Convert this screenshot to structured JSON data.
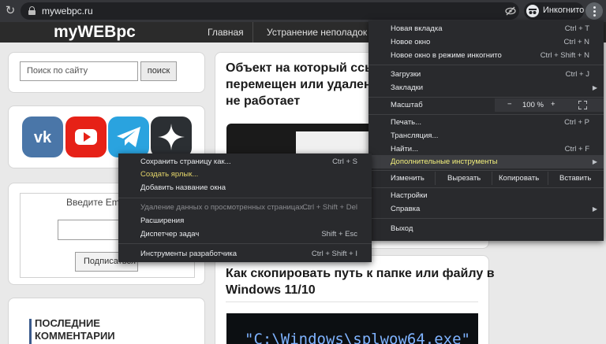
{
  "browser": {
    "url": "mywebpc.ru",
    "incognito_label": "Инкогнито"
  },
  "site": {
    "logo": "myWEBpc",
    "nav": [
      "Главная",
      "Устранение неполадок Win"
    ]
  },
  "sidebar": {
    "search_placeholder": "Поиск по сайту",
    "search_button": "поиск",
    "email_prompt": "Введите Email",
    "subscribe_button": "Подписаться",
    "comments_heading_line1": "ПОСЛЕДНИЕ",
    "comments_heading_line2": "КОММЕНТАРИИ",
    "socials": [
      {
        "name": "vk",
        "color": "#4a76a8"
      },
      {
        "name": "youtube",
        "color": "#e62117"
      },
      {
        "name": "telegram",
        "color": "#2aa3df"
      },
      {
        "name": "zen",
        "color": "#2b2f33"
      }
    ]
  },
  "articles": [
    {
      "title_line1": "Объект на который ссыл",
      "title_line2": "перемещен или удален, к",
      "title_line3": "не работает"
    },
    {
      "title_line1": "Как скопировать путь к папке или файлу в",
      "title_line2": "Windows 11/10",
      "thumb_text": "\"C:\\Windows\\splwow64.exe\""
    }
  ],
  "chrome_menu": {
    "new_tab": "Новая вкладка",
    "new_tab_sc": "Ctrl + T",
    "new_window": "Новое окно",
    "new_window_sc": "Ctrl + N",
    "new_incognito": "Новое окно в режиме инкогнито",
    "new_incognito_sc": "Ctrl + Shift + N",
    "downloads": "Загрузки",
    "downloads_sc": "Ctrl + J",
    "bookmarks": "Закладки",
    "zoom_label": "Масштаб",
    "zoom_minus": "−",
    "zoom_value": "100 %",
    "zoom_plus": "+",
    "print": "Печать...",
    "print_sc": "Ctrl + P",
    "cast": "Трансляция...",
    "find": "Найти...",
    "find_sc": "Ctrl + F",
    "more_tools": "Дополнительные инструменты",
    "edit": "Изменить",
    "cut": "Вырезать",
    "copy": "Копировать",
    "paste": "Вставить",
    "settings": "Настройки",
    "help": "Справка",
    "exit": "Выход"
  },
  "submenu": {
    "save_page": "Сохранить страницу как...",
    "save_page_sc": "Ctrl + S",
    "create_shortcut": "Создать ярлык...",
    "name_window": "Добавить название окна",
    "clear_data": "Удаление данных о просмотренных страницах...",
    "clear_data_sc": "Ctrl + Shift + Del",
    "extensions": "Расширения",
    "task_manager": "Диспетчер задач",
    "task_manager_sc": "Shift + Esc",
    "devtools": "Инструменты разработчика",
    "devtools_sc": "Ctrl + Shift + I"
  }
}
